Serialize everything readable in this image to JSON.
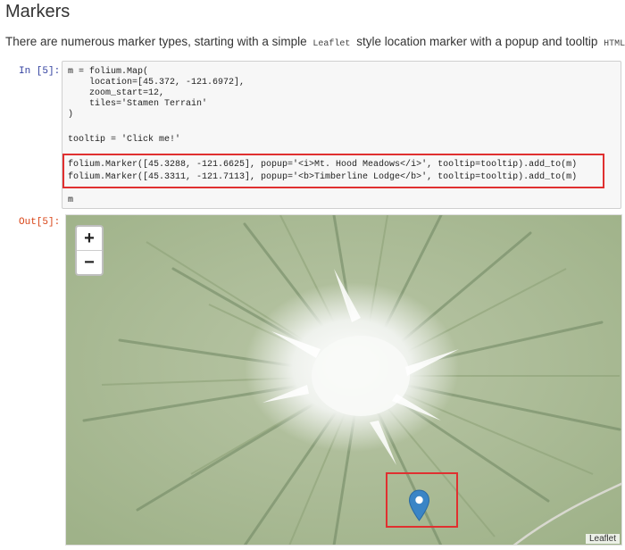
{
  "heading": "Markers",
  "intro": {
    "text_before": "There are numerous marker types, starting with a simple",
    "code1": "Leaflet",
    "text_middle": "style location marker with a popup and tooltip",
    "code2": "HTML",
    "text_end": "."
  },
  "cell": {
    "in_prompt": "In [5]:",
    "out_prompt": "Out[5]:",
    "code_lines": [
      "m = folium.Map(",
      "    location=[45.372, -121.6972],",
      "    zoom_start=12,",
      "    tiles='Stamen Terrain'",
      ")",
      "",
      "tooltip = 'Click me!'",
      "",
      "folium.Marker([45.3288, -121.6625], popup='<i>Mt. Hood Meadows</i>', tooltip=tooltip).add_to(m)",
      "folium.Marker([45.3311, -121.7113], popup='<b>Timberline Lodge</b>', tooltip=tooltip).add_to(m)",
      "",
      "m"
    ]
  },
  "map": {
    "zoom_in": "+",
    "zoom_out": "−",
    "attribution": "Leaflet",
    "marker_color": "#3a85c6",
    "highlight_color": "#e03030",
    "terrain_color": "#a9bc94",
    "snow_color": "#f2f4f1"
  }
}
